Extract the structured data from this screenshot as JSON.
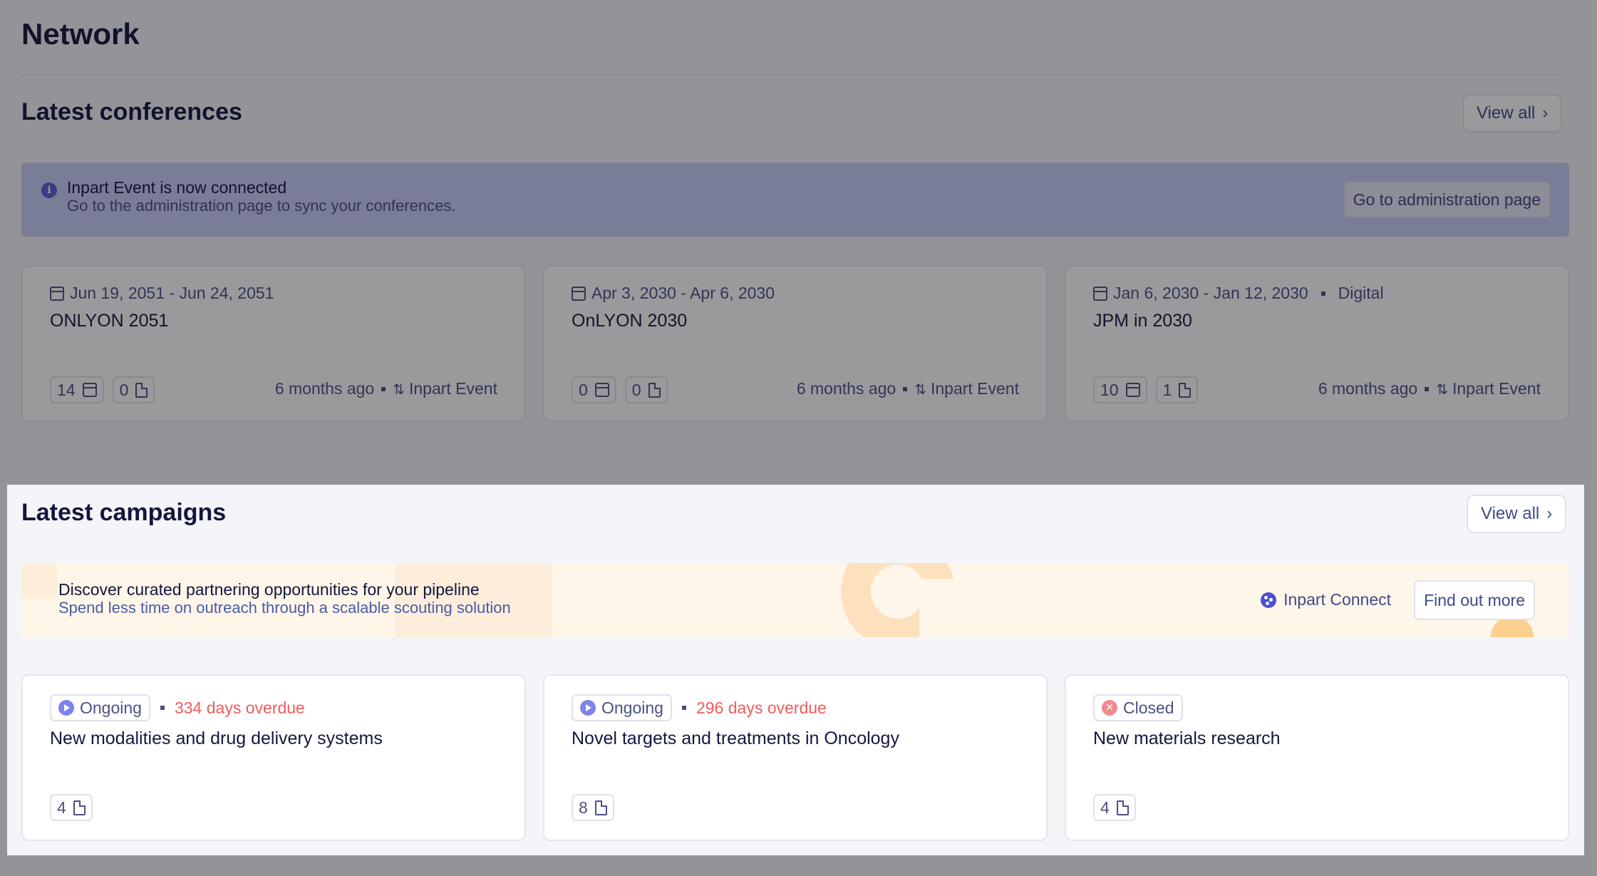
{
  "page": {
    "title": "Network"
  },
  "conferences": {
    "section_title": "Latest conferences",
    "view_all": "View all",
    "banner": {
      "heading": "Inpart Event is now connected",
      "subtext": "Go to the administration page to sync your conferences.",
      "icon": "info-icon",
      "button": "Go to administration page"
    },
    "items": [
      {
        "date": "Jun 19, 2051 - Jun 24, 2051",
        "format": "",
        "name": "ONLYON 2051",
        "meetings": "14",
        "docs": "0",
        "updated": "6 months ago",
        "source": "Inpart Event"
      },
      {
        "date": "Apr 3, 2030 - Apr 6, 2030",
        "format": "",
        "name": "OnLYON 2030",
        "meetings": "0",
        "docs": "0",
        "updated": "6 months ago",
        "source": "Inpart Event"
      },
      {
        "date": "Jan 6, 2030 - Jan 12, 2030",
        "format": "Digital",
        "name": "JPM in 2030",
        "meetings": "10",
        "docs": "1",
        "updated": "6 months ago",
        "source": "Inpart Event"
      }
    ]
  },
  "campaigns": {
    "section_title": "Latest campaigns",
    "view_all": "View all",
    "banner": {
      "heading": "Discover curated partnering opportunities for your pipeline",
      "subtext": "Spend less time on outreach through a scalable scouting solution",
      "brand": "Inpart Connect",
      "button": "Find out more"
    },
    "items": [
      {
        "status": "Ongoing",
        "overdue": "334 days overdue",
        "name": "New modalities and drug delivery systems",
        "docs": "4"
      },
      {
        "status": "Ongoing",
        "overdue": "296 days overdue",
        "name": "Novel targets and treatments in Oncology",
        "docs": "8"
      },
      {
        "status": "Closed",
        "overdue": "",
        "name": "New materials research",
        "docs": "4"
      }
    ]
  },
  "colors": {
    "overdue": "#f05c5c",
    "info_banner": "#c8cdf4",
    "promo_banner": "#fff6ea",
    "ongoing_icon": "#7f82e8",
    "closed_icon": "#f08a8f"
  }
}
